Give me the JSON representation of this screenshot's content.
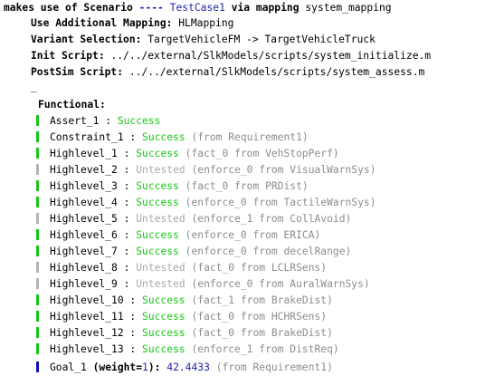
{
  "header": {
    "prefix": "makes use of Scenario",
    "dashes": "----",
    "testcase": "TestCase1",
    "via": "via mapping",
    "mapping": "system_mapping"
  },
  "options": [
    {
      "label": "Use Additional Mapping:",
      "value": "HLMapping"
    },
    {
      "label": "Variant Selection:",
      "value": "TargetVehicleFM -> TargetVehicleTruck"
    },
    {
      "label": "Init Script:",
      "value": "../../external/SlkModels/scripts/system_initialize.m"
    },
    {
      "label": "PostSim Script:",
      "value": "../../external/SlkModels/scripts/system_assess.m"
    }
  ],
  "separator": "_",
  "functional_title": "Functional:",
  "colors": {
    "success": "#16c816",
    "untested": "#a8a8a8",
    "goal": "#1f1fa8",
    "source": "#8c8c8c"
  },
  "results": [
    {
      "name": "Assert_1 :",
      "status": "Success",
      "kind": "success",
      "source": ""
    },
    {
      "name": "Constraint_1 :",
      "status": "Success",
      "kind": "success",
      "source": "(from Requirement1)"
    },
    {
      "name": "Highlevel_1 :",
      "status": "Success",
      "kind": "success",
      "source": "(fact_0 from VehStopPerf)"
    },
    {
      "name": "Highlevel_2 :",
      "status": "Untested",
      "kind": "untested",
      "source": "(enforce_0 from VisualWarnSys)"
    },
    {
      "name": "Highlevel_3 :",
      "status": "Success",
      "kind": "success",
      "source": "(fact_0 from PRDist)"
    },
    {
      "name": "Highlevel_4 :",
      "status": "Success",
      "kind": "success",
      "source": "(enforce_0 from TactileWarnSys)"
    },
    {
      "name": "Highlevel_5 :",
      "status": "Untested",
      "kind": "untested",
      "source": "(enforce_1 from CollAvoid)"
    },
    {
      "name": "Highlevel_6 :",
      "status": "Success",
      "kind": "success",
      "source": "(enforce_0 from ERICA)"
    },
    {
      "name": "Highlevel_7 :",
      "status": "Success",
      "kind": "success",
      "source": "(enforce_0 from decelRange)"
    },
    {
      "name": "Highlevel_8 :",
      "status": "Untested",
      "kind": "untested",
      "source": "(fact_0 from LCLRSens)"
    },
    {
      "name": "Highlevel_9 :",
      "status": "Untested",
      "kind": "untested",
      "source": "(enforce_0 from AuralWarnSys)"
    },
    {
      "name": "Highlevel_10 :",
      "status": "Success",
      "kind": "success",
      "source": "(fact_1 from BrakeDist)"
    },
    {
      "name": "Highlevel_11 :",
      "status": "Success",
      "kind": "success",
      "source": "(fact_0 from HCHRSens)"
    },
    {
      "name": "Highlevel_12 :",
      "status": "Success",
      "kind": "success",
      "source": "(fact_0 from BrakeDist)"
    },
    {
      "name": "Highlevel_13 :",
      "status": "Success",
      "kind": "success",
      "source": "(enforce_1 from DistReq)"
    }
  ],
  "goal": {
    "name": "Goal_1",
    "weight_label": "(weight=",
    "weight_value": "1",
    "weight_close": "):",
    "value": "42.4433",
    "source": "(from Requirement1)"
  }
}
